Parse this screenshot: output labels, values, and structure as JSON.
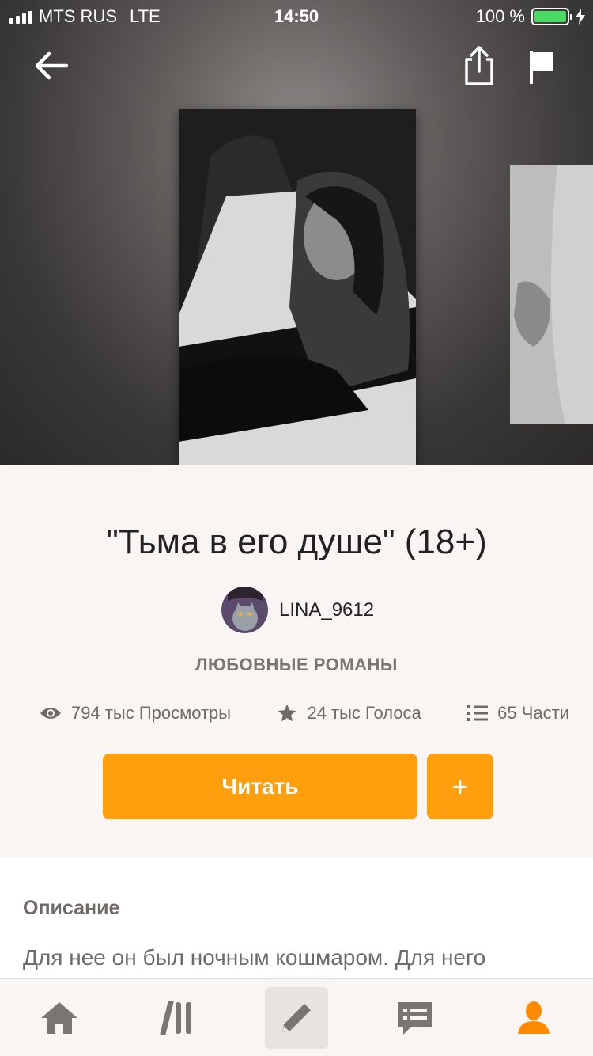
{
  "status_bar": {
    "carrier": "MTS RUS",
    "network": "LTE",
    "time": "14:50",
    "battery": "100 %"
  },
  "nav": {
    "back_icon": "arrow-left-icon",
    "share_icon": "share-icon",
    "flag_icon": "flag-icon"
  },
  "story": {
    "title": "\"Тьма в его душе\" (18+)",
    "author": "LINA_9612",
    "genre": "ЛЮБОВНЫЕ РОМАНЫ",
    "stats": {
      "views": "794 тыс Просмотры",
      "votes": "24 тыс Голоса",
      "parts": "65 Части"
    }
  },
  "actions": {
    "read_label": "Читать",
    "add_label": "+"
  },
  "description": {
    "heading": "Описание",
    "text": "Для нее он был ночным кошмаром. Для него"
  },
  "tabbar": {
    "items": [
      {
        "icon": "home-icon"
      },
      {
        "icon": "library-icon"
      },
      {
        "icon": "write-icon"
      },
      {
        "icon": "messages-icon"
      },
      {
        "icon": "profile-icon"
      }
    ],
    "active_color": "#ff8a00",
    "inactive_color": "#7a7572"
  },
  "colors": {
    "accent": "#ff9f0e",
    "background": "#f8f5f2"
  }
}
